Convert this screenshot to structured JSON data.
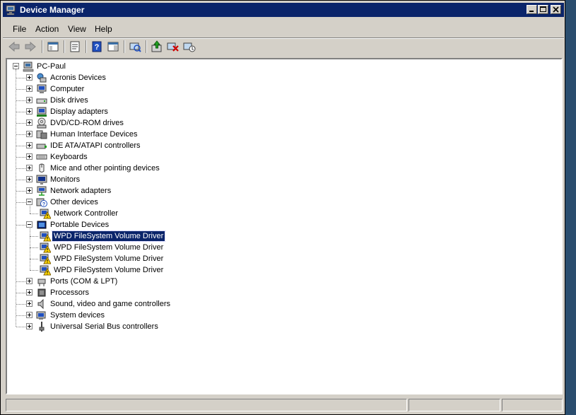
{
  "window": {
    "title": "Device Manager"
  },
  "menubar": {
    "items": [
      "File",
      "Action",
      "View",
      "Help"
    ]
  },
  "tree": {
    "root": {
      "label": "PC-Paul"
    },
    "categories": [
      {
        "label": "Acronis Devices",
        "icon": "acronis-icon"
      },
      {
        "label": "Computer",
        "icon": "computer-icon"
      },
      {
        "label": "Disk drives",
        "icon": "disk-drive-icon"
      },
      {
        "label": "Display adapters",
        "icon": "display-adapter-icon"
      },
      {
        "label": "DVD/CD-ROM drives",
        "icon": "dvd-drive-icon"
      },
      {
        "label": "Human Interface Devices",
        "icon": "hid-icon"
      },
      {
        "label": "IDE ATA/ATAPI controllers",
        "icon": "ide-controller-icon"
      },
      {
        "label": "Keyboards",
        "icon": "keyboard-icon"
      },
      {
        "label": "Mice and other pointing devices",
        "icon": "mouse-icon"
      },
      {
        "label": "Monitors",
        "icon": "monitor-icon"
      },
      {
        "label": "Network adapters",
        "icon": "network-adapter-icon"
      },
      {
        "label": "Other devices",
        "icon": "other-devices-icon",
        "expanded": true
      },
      {
        "label": "Network Controller",
        "icon": "warning-device-icon",
        "child": true
      },
      {
        "label": "Portable Devices",
        "icon": "portable-devices-icon",
        "expanded": true
      },
      {
        "label": "WPD FileSystem Volume Driver",
        "icon": "warning-device-icon",
        "child": true,
        "selected": true
      },
      {
        "label": "WPD FileSystem Volume Driver",
        "icon": "warning-device-icon",
        "child": true
      },
      {
        "label": "WPD FileSystem Volume Driver",
        "icon": "warning-device-icon",
        "child": true
      },
      {
        "label": "WPD FileSystem Volume Driver",
        "icon": "warning-device-icon",
        "child": true
      },
      {
        "label": "Ports (COM & LPT)",
        "icon": "port-icon"
      },
      {
        "label": "Processors",
        "icon": "processor-icon"
      },
      {
        "label": "Sound, video and game controllers",
        "icon": "sound-icon"
      },
      {
        "label": "System devices",
        "icon": "system-devices-icon"
      },
      {
        "label": "Universal Serial Bus controllers",
        "icon": "usb-icon"
      }
    ]
  },
  "colors": {
    "titlebar": "#0a246a",
    "selection": "#0a246a",
    "face": "#d4d0c8"
  }
}
